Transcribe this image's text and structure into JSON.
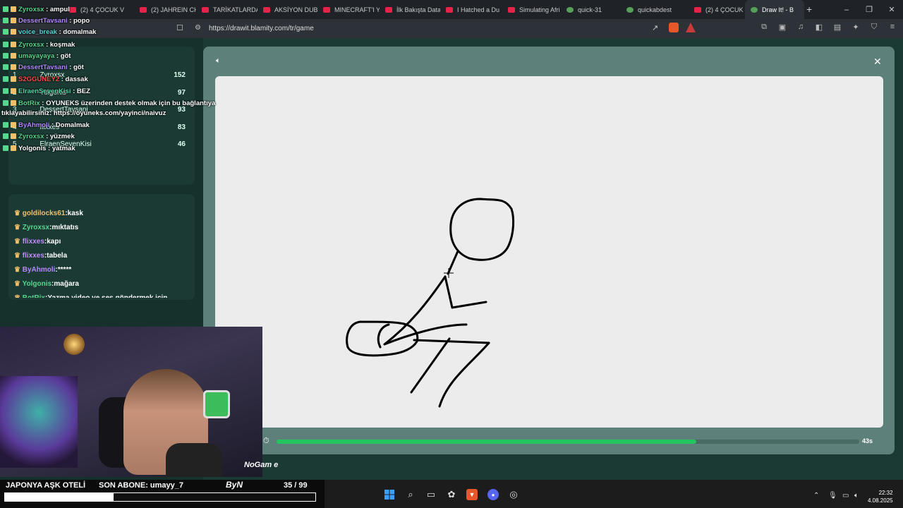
{
  "browser": {
    "tabs": [
      {
        "label": "(2) 4 ÇOCUK V",
        "fav": "youtube"
      },
      {
        "label": "(2) JAHREIN CH",
        "fav": "youtube"
      },
      {
        "label": "TARİKATLARDA",
        "fav": "youtube"
      },
      {
        "label": "AKSİYON DUB",
        "fav": "youtube"
      },
      {
        "label": "MINECRAFT'I Y",
        "fav": "youtube"
      },
      {
        "label": "İlk Bakışta Data",
        "fav": "youtube"
      },
      {
        "label": "I Hatched a Du",
        "fav": "youtube"
      },
      {
        "label": "Simulating Afri",
        "fav": "youtube"
      },
      {
        "label": "quick-31",
        "fav": "game"
      },
      {
        "label": "quickabdest",
        "fav": "game"
      },
      {
        "label": "(2) 4 ÇOCUK V",
        "fav": "youtube"
      },
      {
        "label": "Draw It! - B",
        "fav": "game",
        "active": true
      }
    ],
    "url": "https://drawit.blamity.com/tr/game",
    "window_controls": [
      "minimize-icon",
      "restore-icon",
      "close-icon"
    ]
  },
  "overlay_chat": [
    {
      "user": "Zyroxsx",
      "text": "ampul",
      "color": "#58d68d"
    },
    {
      "user": "DessertTavsani",
      "text": "popo",
      "color": "#b389ff"
    },
    {
      "user": "voice_break",
      "text": "domalmak",
      "color": "#58d6d6"
    },
    {
      "user": "Zyroxsx",
      "text": "koşmak",
      "color": "#58d68d"
    },
    {
      "user": "umayayaya",
      "text": "göt",
      "color": "#58d68d"
    },
    {
      "user": "DessertTavsani",
      "text": "göt",
      "color": "#b389ff"
    },
    {
      "user": "S2GGUNEY2",
      "text": "dassak",
      "color": "#ff4b4b"
    },
    {
      "user": "ElraenSevenKisi",
      "text": "BEZ",
      "color": "#58d6a8"
    },
    {
      "user": "BotRix",
      "text": "OYUNEKS üzerinden destek olmak için bu bağlantıya",
      "color": "#58d68d"
    },
    {
      "user": "",
      "text": "tıklayabilirsiniz: https://oyuneks.com/yayinci/naivuz",
      "color": "#ffffff"
    },
    {
      "user": "ByAhmoli",
      "text": "Domalmak",
      "color": "#b389ff"
    },
    {
      "user": "Zyroxsx",
      "text": "yüzmek",
      "color": "#58d68d"
    },
    {
      "user": "Yolgonis",
      "text": "yatmak",
      "color": "#ffffff"
    }
  ],
  "leaderboard": [
    {
      "rank": "1",
      "name": "Zyroxsx",
      "score": "152"
    },
    {
      "rank": "2",
      "name": "Yolgonis",
      "score": "97"
    },
    {
      "rank": "3",
      "name": "DessertTavsani",
      "score": "93"
    },
    {
      "rank": "4",
      "name": "flixxes",
      "score": "83"
    },
    {
      "rank": "5",
      "name": "ElraenSevenKisi",
      "score": "46"
    }
  ],
  "game_chat": [
    {
      "user": "goldilocks61",
      "text": "kask",
      "color": "#f3c06a"
    },
    {
      "user": "Zyroxsx",
      "text": "mıktatıs",
      "color": "#58d68d"
    },
    {
      "user": "flixxes",
      "text": "kapı",
      "color": "#c38bff"
    },
    {
      "user": "flixxes",
      "text": "tabela",
      "color": "#c38bff"
    },
    {
      "user": "ByAhmoli",
      "text": "*****",
      "color": "#b389ff"
    },
    {
      "user": "Yolgonis",
      "text": "mağara",
      "color": "#58d68d"
    },
    {
      "user": "BotRix",
      "text": "Yazma video ve ses göndermek için",
      "color": "#58d68d"
    }
  ],
  "game": {
    "timer_text": "43s",
    "timer_progress": 0.72
  },
  "stream_bar": {
    "title": "JAPONYA AŞK OTELİ",
    "last_sub": "SON ABONE: umayy_7",
    "logo": "ByN",
    "count": "35  / 99",
    "progress": 0.35,
    "watermark": "NoGam e"
  },
  "taskbar": {
    "time": "22:32",
    "date": "4.08.2025"
  }
}
